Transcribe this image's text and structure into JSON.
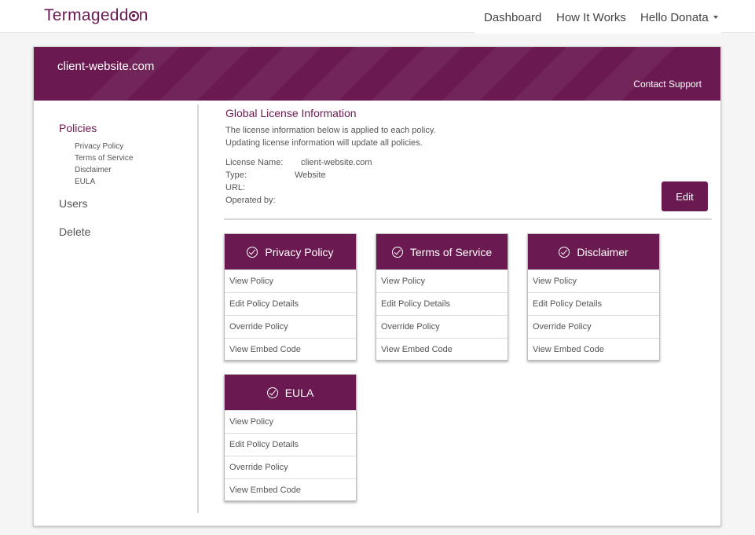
{
  "topbar": {
    "logo_prefix": "Termagedd",
    "logo_suffix": "n",
    "nav": [
      "Dashboard",
      "How It Works",
      "Hello Donata"
    ]
  },
  "banner": {
    "domain": "client-website.com",
    "contact": "Contact Support"
  },
  "sidebar": {
    "policies": "Policies",
    "subitems": [
      "Privacy Policy",
      "Terms of Service",
      "Disclaimer",
      "EULA"
    ],
    "users": "Users",
    "delete": "Delete"
  },
  "license": {
    "title": "Global License Information",
    "desc1": "The license information below is applied to each policy.",
    "desc2": "Updating license information will update all policies.",
    "labels": [
      "License Name:",
      "Type:",
      "URL:",
      "Operated by:"
    ],
    "name_value": "client-website.com",
    "type_value": "Website",
    "edit": "Edit"
  },
  "policies": [
    {
      "title": "Privacy Policy",
      "actions": [
        "View Policy",
        "Edit Policy Details",
        "Override Policy",
        "View Embed Code"
      ]
    },
    {
      "title": "Terms of Service",
      "actions": [
        "View Policy",
        "Edit Policy Details",
        "Override Policy",
        "View Embed Code"
      ]
    },
    {
      "title": "Disclaimer",
      "actions": [
        "View Policy",
        "Edit Policy Details",
        "Override Policy",
        "View Embed Code"
      ]
    },
    {
      "title": "EULA",
      "actions": [
        "View Policy",
        "Edit Policy Details",
        "Override Policy",
        "View Embed Code"
      ]
    }
  ],
  "colors": {
    "brand": "#6a1a50"
  }
}
